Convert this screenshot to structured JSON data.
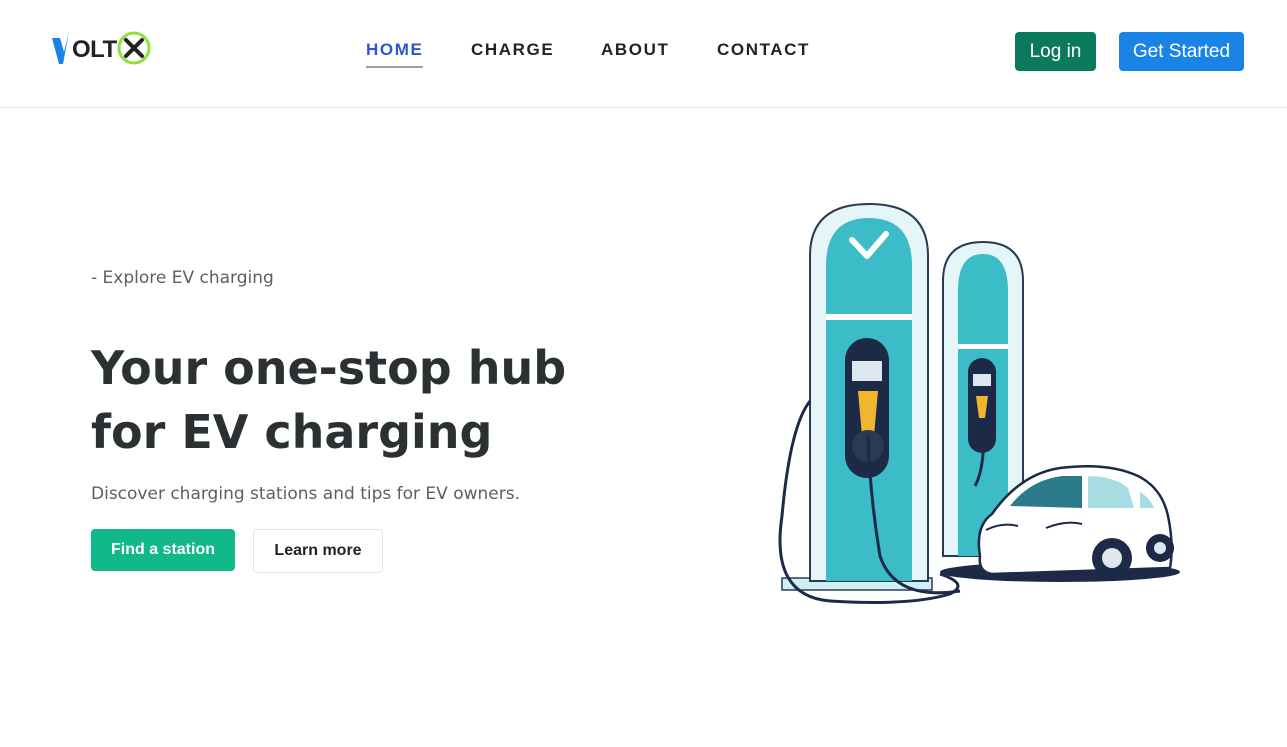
{
  "brand": {
    "logo_text": "VOLTX",
    "logo_icon": "lightning-bolt-icon",
    "accent_color": "#8ee03a"
  },
  "nav": {
    "items": [
      {
        "label": "HOME",
        "active": true
      },
      {
        "label": "CHARGE",
        "active": false
      },
      {
        "label": "ABOUT",
        "active": false
      },
      {
        "label": "CONTACT",
        "active": false
      }
    ]
  },
  "header_actions": {
    "login_label": "Log in",
    "get_started_label": "Get Started"
  },
  "hero": {
    "eyebrow": "- Explore EV charging",
    "headline": "Your one-stop hub for EV charging",
    "subtext": "Discover charging stations and tips for EV owners.",
    "primary_cta": "Find a station",
    "secondary_cta": "Learn more",
    "illustration": "ev-charging-station-illustration"
  },
  "colors": {
    "nav_active": "#2f55d4",
    "login_bg": "#0b7a5c",
    "get_started_bg": "#1a84e6",
    "find_station_bg": "#10b88a",
    "heading_text": "#2b3133",
    "teal": "#3bbcc6"
  }
}
